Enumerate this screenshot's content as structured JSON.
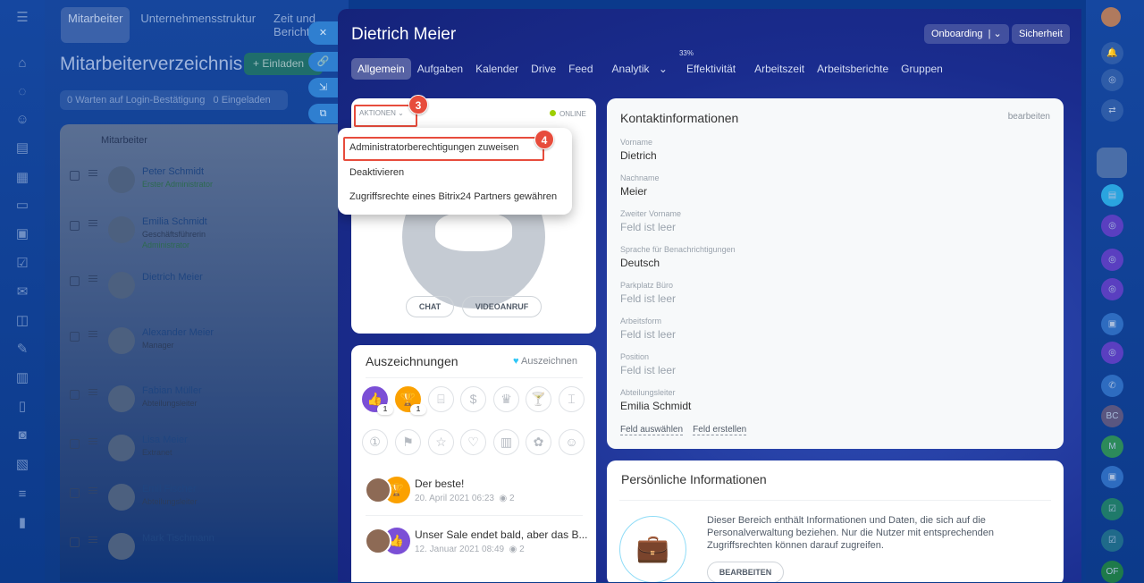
{
  "background_page": {
    "top_nav": [
      "Mitarbeiter",
      "Unternehmensstruktur",
      "Zeit und Berichte"
    ],
    "title": "Mitarbeiterverzeichnis",
    "invite_button": "+ Einladen",
    "filters": [
      {
        "count": "0",
        "label": "Warten auf Login-Bestätigung"
      },
      {
        "count": "0",
        "label": "Eingeladen"
      }
    ],
    "grid_header": "Mitarbeiter",
    "employees": [
      {
        "name": "Peter Schmidt",
        "role": "",
        "status": "Erster Administrator"
      },
      {
        "name": "Emilia Schmidt",
        "role": "Geschäftsführerin",
        "status": "Administrator"
      },
      {
        "name": "Dietrich Meier",
        "role": "",
        "status": ""
      },
      {
        "name": "Alexander Meier",
        "role": "Manager",
        "status": ""
      },
      {
        "name": "Fabian Müller",
        "role": "Abteilungsleiter",
        "status": ""
      },
      {
        "name": "Lisa Meier",
        "role": "Extranet",
        "status": ""
      },
      {
        "name": "Emil Fischer",
        "role": "Abteilungsleiter",
        "status": ""
      },
      {
        "name": "Mark Tischmann",
        "role": "",
        "status": ""
      }
    ]
  },
  "profile": {
    "name": "Dietrich Meier",
    "onboarding_button": "Onboarding",
    "security_button": "Sicherheit",
    "tabs": [
      "Allgemein",
      "Aufgaben",
      "Kalender",
      "Drive",
      "Feed",
      "Analytik",
      "Effektivität",
      "Arbeitszeit",
      "Arbeitsberichte",
      "Gruppen"
    ],
    "effectiveness_percent": "33%",
    "actions_label": "AKTIONEN",
    "online_status": "ONLINE",
    "actions_menu": [
      "Administratorberechtigungen zuweisen",
      "Deaktivieren",
      "Zugriffsrechte eines Bitrix24 Partners gewähren"
    ],
    "step_badges": [
      "3",
      "4"
    ],
    "chat_button": "CHAT",
    "video_button": "VIDEOANRUF"
  },
  "awards": {
    "title": "Auszeichnungen",
    "give_award": "Auszeichnen",
    "counts": [
      "1",
      "1"
    ],
    "posts": [
      {
        "title": "Der beste!",
        "date": "20. April 2021 06:23",
        "views": "2"
      },
      {
        "title": "Unser Sale endet bald, aber das B...",
        "date": "12. Januar 2021 08:49",
        "views": "2"
      }
    ]
  },
  "contact": {
    "title": "Kontaktinformationen",
    "edit": "bearbeiten",
    "fields": [
      {
        "label": "Vorname",
        "value": "Dietrich"
      },
      {
        "label": "Nachname",
        "value": "Meier"
      },
      {
        "label": "Zweiter Vorname",
        "value": "Feld ist leer"
      },
      {
        "label": "Sprache für Benachrichtigungen",
        "value": "Deutsch"
      },
      {
        "label": "Parkplatz Büro",
        "value": "Feld ist leer"
      },
      {
        "label": "Arbeitsform",
        "value": "Feld ist leer"
      },
      {
        "label": "Position",
        "value": "Feld ist leer"
      },
      {
        "label": "Abteilungsleiter",
        "value": "Emilia Schmidt"
      }
    ],
    "select_field": "Feld auswählen",
    "create_field": "Feld erstellen"
  },
  "personal": {
    "title": "Persönliche Informationen",
    "description": "Dieser Bereich enthält Informationen und Daten, die sich auf die Personalverwaltung beziehen. Nur die Nutzer mit entsprechenden Zugriffsrechten können darauf zugreifen.",
    "edit_button": "BEARBEITEN"
  },
  "right_sidebar": {
    "initials": [
      "BC",
      "M",
      "OF"
    ]
  }
}
